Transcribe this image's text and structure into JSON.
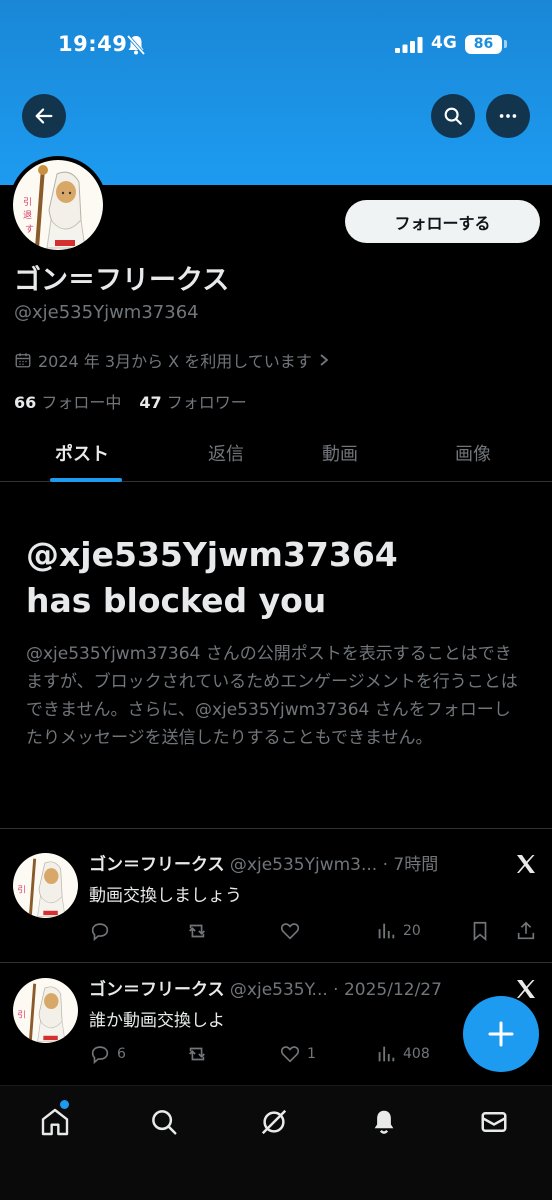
{
  "status_bar": {
    "time": "19:49",
    "network": "4G",
    "battery": "86"
  },
  "profile": {
    "display_name": "ゴン＝フリークス",
    "handle": "@xje535Yjwm37364",
    "follow_label": "フォローする",
    "joined": "2024 年 3月から X を利用しています",
    "following_count": "66",
    "following_label": "フォロー中",
    "followers_count": "47",
    "followers_label": "フォロワー"
  },
  "tabs": [
    {
      "label": "ポスト"
    },
    {
      "label": "返信"
    },
    {
      "label": "動画"
    },
    {
      "label": "画像"
    }
  ],
  "blocked": {
    "title_line1": "@xje535Yjwm37364",
    "title_line2": "has blocked you",
    "body": "@xje535Yjwm37364 さんの公開ポストを表示することはできますが、ブロックされているためエンゲージメントを行うことはできません。さらに、@xje535Yjwm37364 さんをフォローしたりメッセージを送信したりすることもできません。"
  },
  "posts": [
    {
      "name": "ゴン＝フリークス",
      "meta": "@xje535Yjwm3... · 7時間",
      "text": "動画交換しましょう",
      "replies": "",
      "reposts": "",
      "likes": "",
      "views": "20"
    },
    {
      "name": "ゴン＝フリークス",
      "meta": "@xje535Y... · 2025/12/27",
      "text": "誰か動画交換しよ",
      "replies": "6",
      "reposts": "",
      "likes": "1",
      "views": "408"
    }
  ],
  "icons": {
    "back": "arrow-left-icon",
    "search": "search-icon",
    "more": "more-horizontal-icon",
    "calendar": "calendar-icon",
    "x_logo": "x-logo-icon",
    "compose": "plus-icon"
  },
  "colors": {
    "accent": "#1d9bf0",
    "banner": "#1d9bf0",
    "text_muted": "#71767b"
  }
}
